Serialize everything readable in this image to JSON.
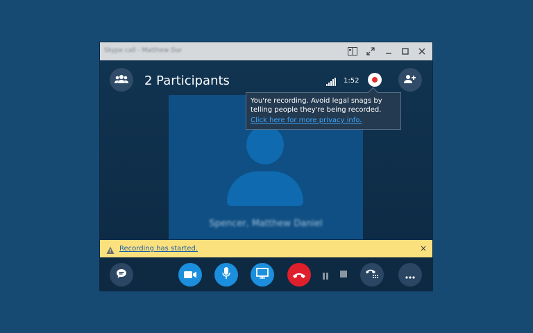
{
  "window": {
    "title": "Skype call - Matthew Daniel",
    "titlebar_buttons": [
      "view-icon",
      "expand-icon",
      "minimize-icon",
      "maximize-icon",
      "close-icon"
    ]
  },
  "call": {
    "participants_label": "2 Participants",
    "duration": "1:52",
    "participant_name": "Spencer, Matthew Daniel"
  },
  "tooltip": {
    "text": "You're recording. Avoid legal snags by telling people they're being recorded.",
    "link": "Click here for more privacy info."
  },
  "notice": {
    "text": "Recording has started.",
    "close_label": "×"
  },
  "controls": [
    "chat-icon",
    "video-icon",
    "mic-icon",
    "screen-share-icon",
    "hangup-icon",
    "pause-icon",
    "stop-icon",
    "dialpad-icon",
    "more-icon"
  ],
  "colors": {
    "background": "#174a72",
    "accent": "#1b8fde",
    "hangup": "#e01f2d",
    "notice": "#fbe17e",
    "record": "#e12e2e"
  }
}
